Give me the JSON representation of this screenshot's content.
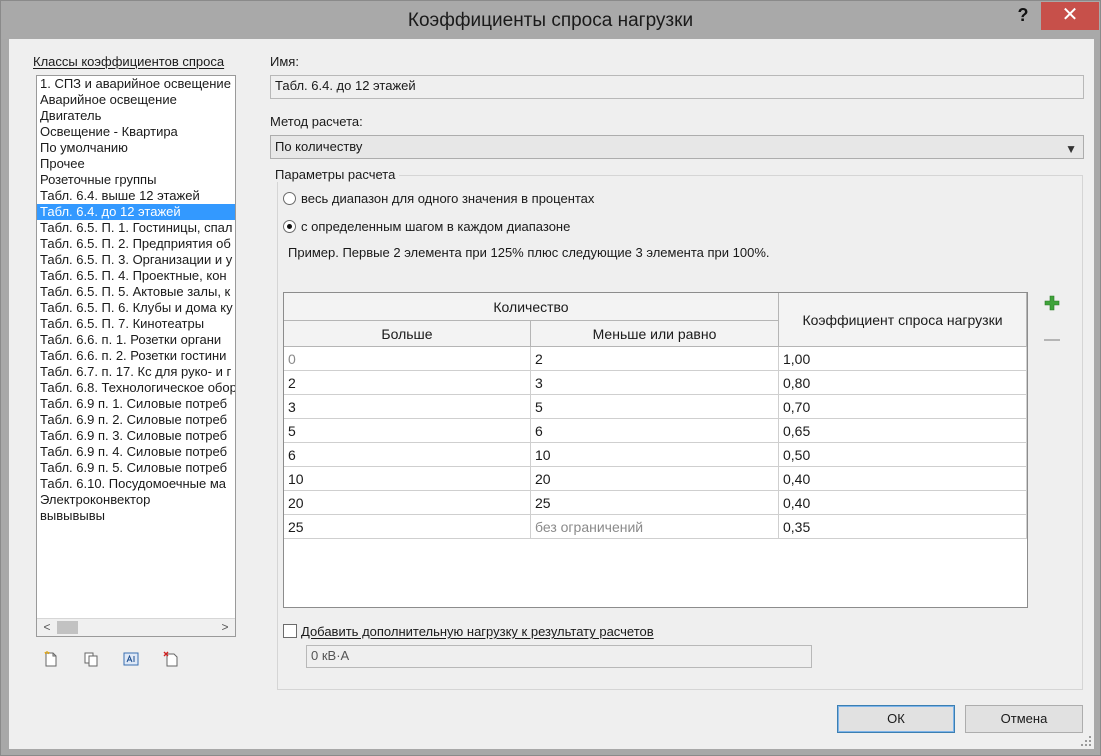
{
  "window": {
    "title": "Коэффициенты спроса нагрузки",
    "help": "?",
    "close": "✕"
  },
  "left_panel": {
    "label": "Классы коэффициентов спроса",
    "items": [
      "1. СПЗ и аварийное освещение",
      "Аварийное освещение",
      "Двигатель",
      "Освещение - Квартира",
      "По умолчанию",
      "Прочее",
      "Розеточные группы",
      "Табл. 6.4. выше 12 этажей",
      "Табл. 6.4. до 12 этажей",
      "Табл. 6.5. П. 1. Гостиницы, спал",
      "Табл. 6.5. П. 2. Предприятия об",
      "Табл. 6.5. П. 3. Организации и у",
      "Табл. 6.5. П. 4. Проектные, кон",
      "Табл. 6.5. П. 5. Актовые залы, к",
      "Табл. 6.5. П. 6. Клубы и дома ку",
      "Табл. 6.5. П. 7. Кинотеатры",
      "Табл. 6.6. п. 1. Розетки органи",
      "Табл. 6.6. п. 2. Розетки гостини",
      "Табл. 6.7. п. 17. Кс для руко- и г",
      "Табл. 6.8. Технологическое обор",
      "Табл. 6.9 п. 1. Силовые потреб",
      "Табл. 6.9 п. 2. Силовые потреб",
      "Табл. 6.9 п. 3. Силовые потреб",
      "Табл. 6.9 п. 4. Силовые потреб",
      "Табл. 6.9 п. 5. Силовые потреб",
      "Табл. 6.10. Посудомоечные ма",
      "Электроконвектор",
      "вывывывы"
    ],
    "selected_index": 8,
    "scroll_left": "<",
    "scroll_right": ">"
  },
  "name_field": {
    "label": "Имя:",
    "value": "Табл. 6.4. до 12 этажей"
  },
  "method": {
    "label": "Метод расчета:",
    "value": "По количеству",
    "arrow": "▼"
  },
  "params": {
    "label": "Параметры расчета",
    "radio1": "весь диапазон для одного значения в процентах",
    "radio2": "с определенным шагом в каждом диапазоне",
    "example": "Пример. Первые 2 элемента при 125% плюс следующие 3 элемента при 100%."
  },
  "table": {
    "group_header": "Количество",
    "col_more": "Больше",
    "col_less": "Меньше или равно",
    "col_coef": "Коэффициент спроса нагрузки",
    "rows": [
      {
        "more": "0",
        "less": "2",
        "coef": "1,00"
      },
      {
        "more": "2",
        "less": "3",
        "coef": "0,80"
      },
      {
        "more": "3",
        "less": "5",
        "coef": "0,70"
      },
      {
        "more": "5",
        "less": "6",
        "coef": "0,65"
      },
      {
        "more": "6",
        "less": "10",
        "coef": "0,50"
      },
      {
        "more": "10",
        "less": "20",
        "coef": "0,40"
      },
      {
        "more": "20",
        "less": "25",
        "coef": "0,40"
      },
      {
        "more": "25",
        "less": "без ограничений",
        "coef": "0,35"
      }
    ]
  },
  "extra_load": {
    "label": "Добавить дополнительную нагрузку к результату расчетов",
    "value": "0 кВ·А"
  },
  "buttons": {
    "ok": "ОК",
    "cancel": "Отмена"
  },
  "colors": {
    "selection": "#3399ff",
    "close_button": "#c7504a",
    "plus_icon": "#3fa33a"
  }
}
